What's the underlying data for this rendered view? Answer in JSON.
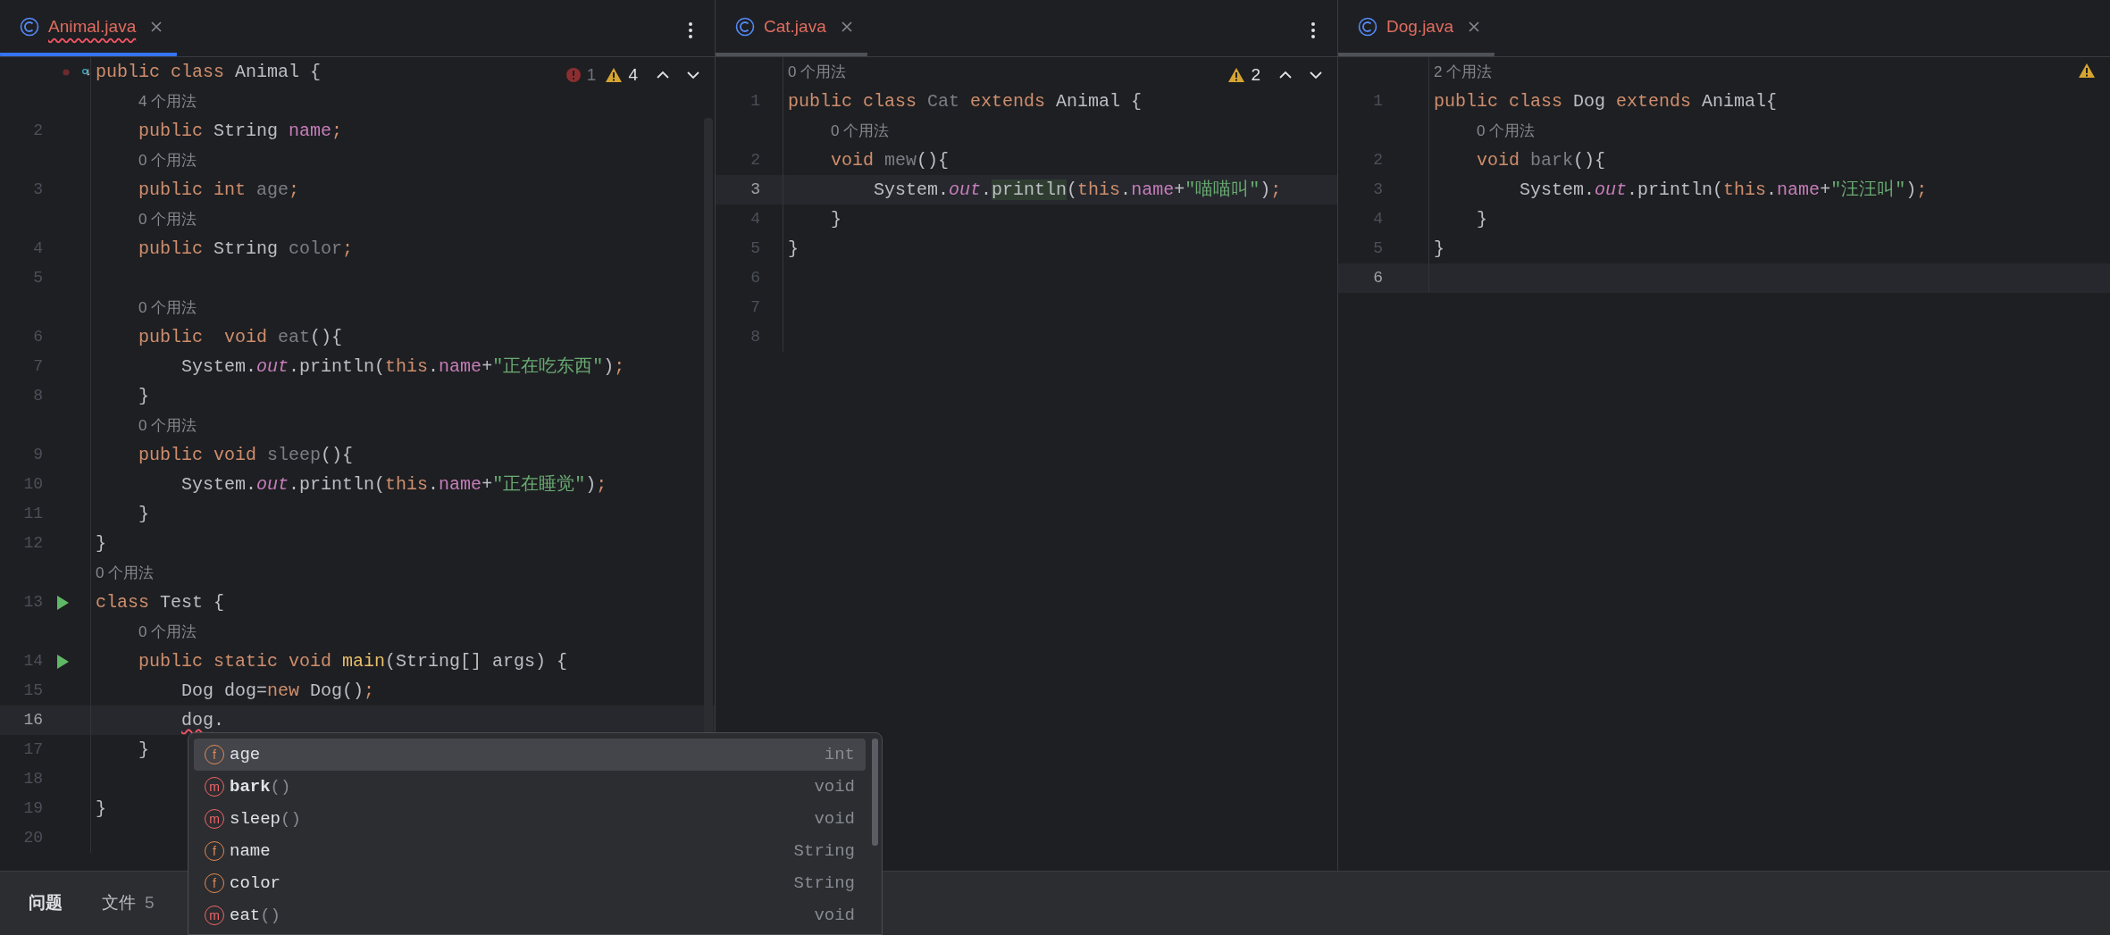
{
  "panes": [
    {
      "tab": {
        "label": "Animal.java",
        "selected": true,
        "error": true
      },
      "inspections": {
        "errors": "1",
        "warnings": "4",
        "navigation": true
      },
      "lines": [
        {
          "kind": "code",
          "gutter": [
            {
              "kind": "breakpoint"
            },
            {
              "kind": "implemented"
            }
          ],
          "current": false,
          "tokens": [
            {
              "kind": "kw",
              "text": "public "
            },
            {
              "kind": "kw",
              "text": "class "
            },
            {
              "kind": "plain",
              "text": "Animal {"
            }
          ]
        },
        {
          "kind": "hint",
          "text": "    4 个用法"
        },
        {
          "kind": "code",
          "number": "2",
          "current": false,
          "tokens": [
            {
              "kind": "kw",
              "text": "    public "
            },
            {
              "kind": "plain",
              "text": "String "
            },
            {
              "kind": "field",
              "text": "name"
            },
            {
              "kind": "semi",
              "text": ";"
            }
          ]
        },
        {
          "kind": "hint",
          "text": "    0 个用法"
        },
        {
          "kind": "code",
          "number": "3",
          "current": false,
          "tokens": [
            {
              "kind": "kw",
              "text": "    public "
            },
            {
              "kind": "kw",
              "text": "int "
            },
            {
              "kind": "unused",
              "text": "age"
            },
            {
              "kind": "semi",
              "text": ";"
            }
          ]
        },
        {
          "kind": "hint",
          "text": "    0 个用法"
        },
        {
          "kind": "code",
          "number": "4",
          "current": false,
          "tokens": [
            {
              "kind": "kw",
              "text": "    public "
            },
            {
              "kind": "plain",
              "text": "String "
            },
            {
              "kind": "unused",
              "text": "color"
            },
            {
              "kind": "semi",
              "text": ";"
            }
          ]
        },
        {
          "kind": "code",
          "number": "5",
          "current": false
        },
        {
          "kind": "hint",
          "text": "    0 个用法"
        },
        {
          "kind": "code",
          "number": "6",
          "current": false,
          "tokens": [
            {
              "kind": "kw",
              "text": "    public  "
            },
            {
              "kind": "kw",
              "text": "void "
            },
            {
              "kind": "unused",
              "text": "eat"
            },
            {
              "kind": "plain",
              "text": "(){"
            }
          ]
        },
        {
          "kind": "code",
          "number": "7",
          "current": false,
          "tokens": [
            {
              "kind": "plain",
              "text": "        System."
            },
            {
              "kind": "static",
              "text": "out"
            },
            {
              "kind": "plain",
              "text": ".println("
            },
            {
              "kind": "kw",
              "text": "this"
            },
            {
              "kind": "plain",
              "text": "."
            },
            {
              "kind": "field",
              "text": "name"
            },
            {
              "kind": "plain",
              "text": "+"
            },
            {
              "kind": "str",
              "text": "\"正在吃东西\""
            },
            {
              "kind": "plain",
              "text": ")"
            },
            {
              "kind": "semi",
              "text": ";"
            }
          ]
        },
        {
          "kind": "code",
          "number": "8",
          "current": false,
          "tokens": [
            {
              "kind": "plain",
              "text": "    }"
            }
          ]
        },
        {
          "kind": "hint",
          "text": "    0 个用法"
        },
        {
          "kind": "code",
          "number": "9",
          "current": false,
          "tokens": [
            {
              "kind": "kw",
              "text": "    public "
            },
            {
              "kind": "kw",
              "text": "void "
            },
            {
              "kind": "unused",
              "text": "sleep"
            },
            {
              "kind": "plain",
              "text": "(){"
            }
          ]
        },
        {
          "kind": "code",
          "number": "10",
          "current": false,
          "tokens": [
            {
              "kind": "plain",
              "text": "        System."
            },
            {
              "kind": "static",
              "text": "out"
            },
            {
              "kind": "plain",
              "text": ".println("
            },
            {
              "kind": "kw",
              "text": "this"
            },
            {
              "kind": "plain",
              "text": "."
            },
            {
              "kind": "field",
              "text": "name"
            },
            {
              "kind": "plain",
              "text": "+"
            },
            {
              "kind": "str",
              "text": "\"正在睡觉\""
            },
            {
              "kind": "plain",
              "text": ")"
            },
            {
              "kind": "semi",
              "text": ";"
            }
          ]
        },
        {
          "kind": "code",
          "number": "11",
          "current": false,
          "tokens": [
            {
              "kind": "plain",
              "text": "    }"
            }
          ]
        },
        {
          "kind": "code",
          "number": "12",
          "current": false,
          "tokens": [
            {
              "kind": "plain",
              "text": "}"
            }
          ]
        },
        {
          "kind": "hint",
          "text": "0 个用法"
        },
        {
          "kind": "code",
          "number": "13",
          "gutter": [
            {
              "kind": "run"
            }
          ],
          "current": false,
          "tokens": [
            {
              "kind": "kw",
              "text": "class "
            },
            {
              "kind": "plain",
              "text": "Test {"
            }
          ]
        },
        {
          "kind": "hint",
          "text": "    0 个用法"
        },
        {
          "kind": "code",
          "number": "14",
          "gutter": [
            {
              "kind": "run"
            }
          ],
          "current": false,
          "tokens": [
            {
              "kind": "kw",
              "text": "    public "
            },
            {
              "kind": "kw",
              "text": "static "
            },
            {
              "kind": "kw",
              "text": "void "
            },
            {
              "kind": "decl",
              "text": "main"
            },
            {
              "kind": "plain",
              "text": "(String[] args) {"
            }
          ]
        },
        {
          "kind": "code",
          "number": "15",
          "current": false,
          "tokens": [
            {
              "kind": "plain",
              "text": "        Dog dog="
            },
            {
              "kind": "kw",
              "text": "new "
            },
            {
              "kind": "plain",
              "text": "Dog()"
            },
            {
              "kind": "semi",
              "text": ";"
            }
          ]
        },
        {
          "kind": "code",
          "number": "16",
          "current": true,
          "tokens": [
            {
              "kind": "error",
              "text": "        dog"
            },
            {
              "kind": "plain",
              "text": "."
            }
          ]
        },
        {
          "kind": "code",
          "number": "17",
          "current": false,
          "tokens": [
            {
              "kind": "plain",
              "text": "    }"
            }
          ]
        },
        {
          "kind": "code",
          "number": "18",
          "current": false
        },
        {
          "kind": "code",
          "number": "19",
          "current": false,
          "tokens": [
            {
              "kind": "plain",
              "text": "}"
            }
          ]
        },
        {
          "kind": "code",
          "number": "20",
          "current": false
        }
      ]
    },
    {
      "tab": {
        "label": "Cat.java",
        "selected": false,
        "error": false
      },
      "inspections": {
        "warnings": "2",
        "navigation": true
      },
      "lines": [
        {
          "kind": "hint",
          "text": "0 个用法"
        },
        {
          "kind": "code",
          "number": "1",
          "current": false,
          "tokens": [
            {
              "kind": "kw",
              "text": "public "
            },
            {
              "kind": "kw",
              "text": "class "
            },
            {
              "kind": "unused",
              "text": "Cat "
            },
            {
              "kind": "kw",
              "text": "extends "
            },
            {
              "kind": "plain",
              "text": "Animal {"
            }
          ]
        },
        {
          "kind": "hint",
          "text": "    0 个用法"
        },
        {
          "kind": "code",
          "number": "2",
          "current": false,
          "tokens": [
            {
              "kind": "kw",
              "text": "    void "
            },
            {
              "kind": "unused",
              "text": "mew"
            },
            {
              "kind": "plain",
              "text": "(){"
            }
          ]
        },
        {
          "kind": "code",
          "number": "3",
          "current": true,
          "tokens": [
            {
              "kind": "plain",
              "text": "        System."
            },
            {
              "kind": "static",
              "text": "out"
            },
            {
              "kind": "plain",
              "text": "."
            },
            {
              "kind": "hl",
              "text": "println"
            },
            {
              "kind": "plain",
              "text": "("
            },
            {
              "kind": "kw",
              "text": "this"
            },
            {
              "kind": "plain",
              "text": "."
            },
            {
              "kind": "field",
              "text": "name"
            },
            {
              "kind": "plain",
              "text": "+"
            },
            {
              "kind": "str",
              "text": "\"喵喵叫\""
            },
            {
              "kind": "plain",
              "text": ")"
            },
            {
              "kind": "semi",
              "text": ";"
            }
          ]
        },
        {
          "kind": "code",
          "number": "4",
          "current": false,
          "tokens": [
            {
              "kind": "plain",
              "text": "    }"
            }
          ]
        },
        {
          "kind": "code",
          "number": "5",
          "current": false,
          "tokens": [
            {
              "kind": "plain",
              "text": "}"
            }
          ]
        },
        {
          "kind": "code",
          "number": "6",
          "current": false
        },
        {
          "kind": "code",
          "number": "7",
          "current": false
        },
        {
          "kind": "code",
          "number": "8",
          "current": false
        }
      ]
    },
    {
      "tab": {
        "label": "Dog.java",
        "selected": false,
        "error": false
      },
      "inspections": {
        "warning_icon": true,
        "navigation": false
      },
      "lines": [
        {
          "kind": "hint",
          "text": "2 个用法"
        },
        {
          "kind": "code",
          "number": "1",
          "current": false,
          "tokens": [
            {
              "kind": "kw",
              "text": "public "
            },
            {
              "kind": "kw",
              "text": "class "
            },
            {
              "kind": "plain",
              "text": "Dog "
            },
            {
              "kind": "kw",
              "text": "extends "
            },
            {
              "kind": "plain",
              "text": "Animal{"
            }
          ]
        },
        {
          "kind": "hint",
          "text": "    0 个用法"
        },
        {
          "kind": "code",
          "number": "2",
          "current": false,
          "tokens": [
            {
              "kind": "kw",
              "text": "    void "
            },
            {
              "kind": "unused",
              "text": "bark"
            },
            {
              "kind": "plain",
              "text": "(){"
            }
          ]
        },
        {
          "kind": "code",
          "number": "3",
          "current": false,
          "tokens": [
            {
              "kind": "plain",
              "text": "        System."
            },
            {
              "kind": "static",
              "text": "out"
            },
            {
              "kind": "plain",
              "text": ".println("
            },
            {
              "kind": "kw",
              "text": "this"
            },
            {
              "kind": "plain",
              "text": "."
            },
            {
              "kind": "field",
              "text": "name"
            },
            {
              "kind": "plain",
              "text": "+"
            },
            {
              "kind": "str",
              "text": "\"汪汪叫\""
            },
            {
              "kind": "plain",
              "text": ")"
            },
            {
              "kind": "semi",
              "text": ";"
            }
          ]
        },
        {
          "kind": "code",
          "number": "4",
          "current": false,
          "tokens": [
            {
              "kind": "plain",
              "text": "    }"
            }
          ]
        },
        {
          "kind": "code",
          "number": "5",
          "current": false,
          "tokens": [
            {
              "kind": "plain",
              "text": "}"
            }
          ]
        },
        {
          "kind": "code",
          "number": "6",
          "current": true
        }
      ]
    }
  ],
  "completion": {
    "items": [
      {
        "badge": "f",
        "kind": "field",
        "name": "age",
        "type": "int",
        "bold": false,
        "selected": true
      },
      {
        "badge": "m",
        "kind": "method",
        "name": "bark",
        "params": "()",
        "type": "void",
        "bold": true,
        "selected": false
      },
      {
        "badge": "m",
        "kind": "method",
        "name": "sleep",
        "params": "()",
        "type": "void",
        "bold": false,
        "selected": false
      },
      {
        "badge": "f",
        "kind": "field",
        "name": "name",
        "type": "String",
        "bold": false,
        "selected": false
      },
      {
        "badge": "f",
        "kind": "field",
        "name": "color",
        "type": "String",
        "bold": false,
        "selected": false
      },
      {
        "badge": "m",
        "kind": "method",
        "name": "eat",
        "params": "()",
        "type": "void",
        "bold": false,
        "selected": false
      }
    ]
  },
  "bottom_panel": {
    "tabs": [
      {
        "label": "问题",
        "selected": true
      },
      {
        "label": "文件",
        "count": "5",
        "selected": false
      }
    ]
  }
}
